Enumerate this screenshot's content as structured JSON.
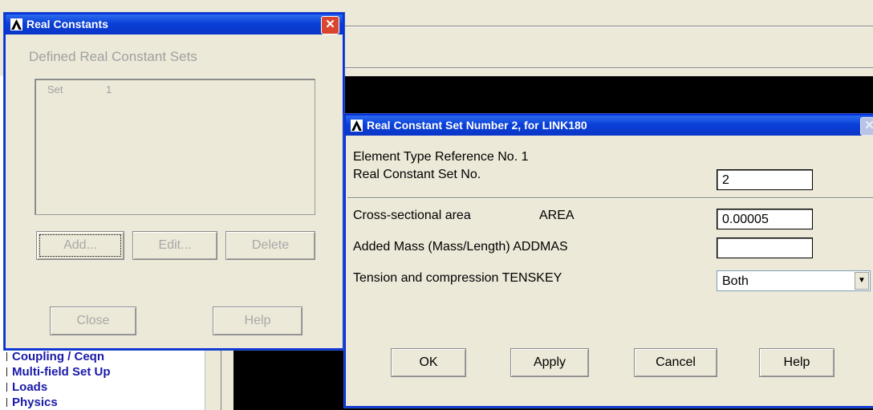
{
  "real_constants_dialog": {
    "title": "Real Constants",
    "group_label": "Defined Real Constant Sets",
    "list_header": "Set",
    "list_value": "1",
    "add_label": "Add...",
    "edit_label": "Edit...",
    "delete_label": "Delete",
    "close_label": "Close",
    "help_label": "Help"
  },
  "set_dialog": {
    "title": "Real Constant Set Number 2, for LINK180",
    "element_type_ref": "Element Type Reference No. 1",
    "set_no_label": "Real Constant Set No.",
    "set_no_value": "2",
    "area_label": "Cross-sectional area",
    "area_code": "AREA",
    "area_value": "0.00005",
    "addmas_label": "Added Mass (Mass/Length) ADDMAS",
    "addmas_value": "",
    "tenskey_label": "Tension and compression TENSKEY",
    "tenskey_value": "Both",
    "ok_label": "OK",
    "apply_label": "Apply",
    "cancel_label": "Cancel",
    "help_label": "Help"
  },
  "tree_menu": {
    "items": [
      "Coupling / Ceqn",
      "Multi-field Set Up",
      "Loads",
      "Physics"
    ]
  },
  "icons": {
    "logo": "ansys-logo-icon",
    "close": "close-icon",
    "dropdown": "chevron-down-icon"
  },
  "colors": {
    "titlebar": "#0a3fd6",
    "dialog_bg": "#ece9d8",
    "tree_text": "#1a1aa8"
  }
}
